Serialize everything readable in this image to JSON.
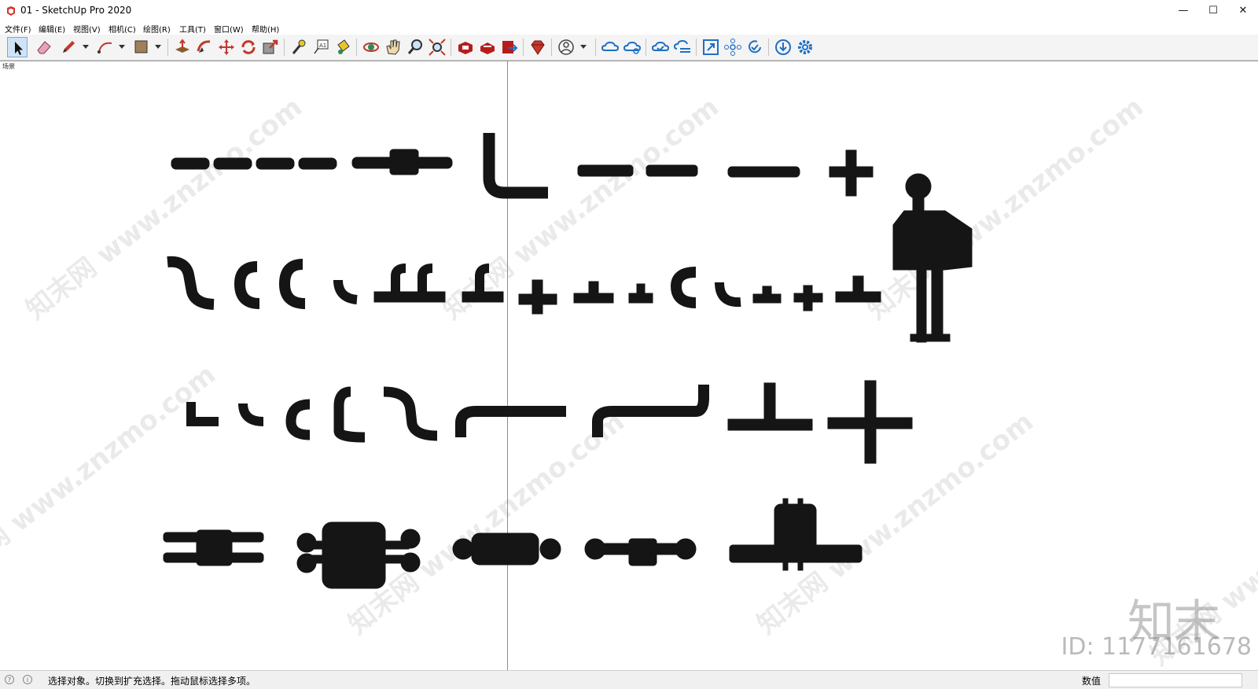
{
  "window": {
    "title": "01 - SketchUp Pro 2020",
    "minimize": "—",
    "maximize": "☐",
    "close": "✕"
  },
  "menu": [
    {
      "label": "文件(F)"
    },
    {
      "label": "编辑(E)"
    },
    {
      "label": "视图(V)"
    },
    {
      "label": "相机(C)"
    },
    {
      "label": "绘图(R)"
    },
    {
      "label": "工具(T)"
    },
    {
      "label": "窗口(W)"
    },
    {
      "label": "帮助(H)"
    }
  ],
  "toolbar": {
    "icons": [
      "select-icon",
      "eraser-icon",
      "pencil-icon",
      "arc-icon",
      "shape-icon",
      "push-pull-icon",
      "follow-me-icon",
      "move-icon",
      "rotate-icon",
      "scale-icon",
      "tape-measure-icon",
      "text-label-icon",
      "paint-bucket-icon",
      "orbit-icon",
      "pan-icon",
      "zoom-icon",
      "zoom-extents-icon",
      "warehouse-icon",
      "extension-warehouse-icon",
      "send-to-layout-icon",
      "ruby-icon",
      "account-icon",
      "cloud-share-icon",
      "cloud-model-icon",
      "cloud-sync-icon",
      "cloud-list-icon",
      "zoom-window-icon",
      "network-icon",
      "refresh-check-icon",
      "download-icon",
      "settings-icon"
    ],
    "accent": "#1f6fc5"
  },
  "viewport": {
    "scene_tab": "场景"
  },
  "watermark": {
    "text": "知末网 www.znzmo.com",
    "logo": "知末",
    "id": "ID: 1177161678"
  },
  "status": {
    "message": "选择对象。切换到扩充选择。拖动鼠标选择多项。",
    "measure_label": "数值",
    "measure_value": ""
  }
}
